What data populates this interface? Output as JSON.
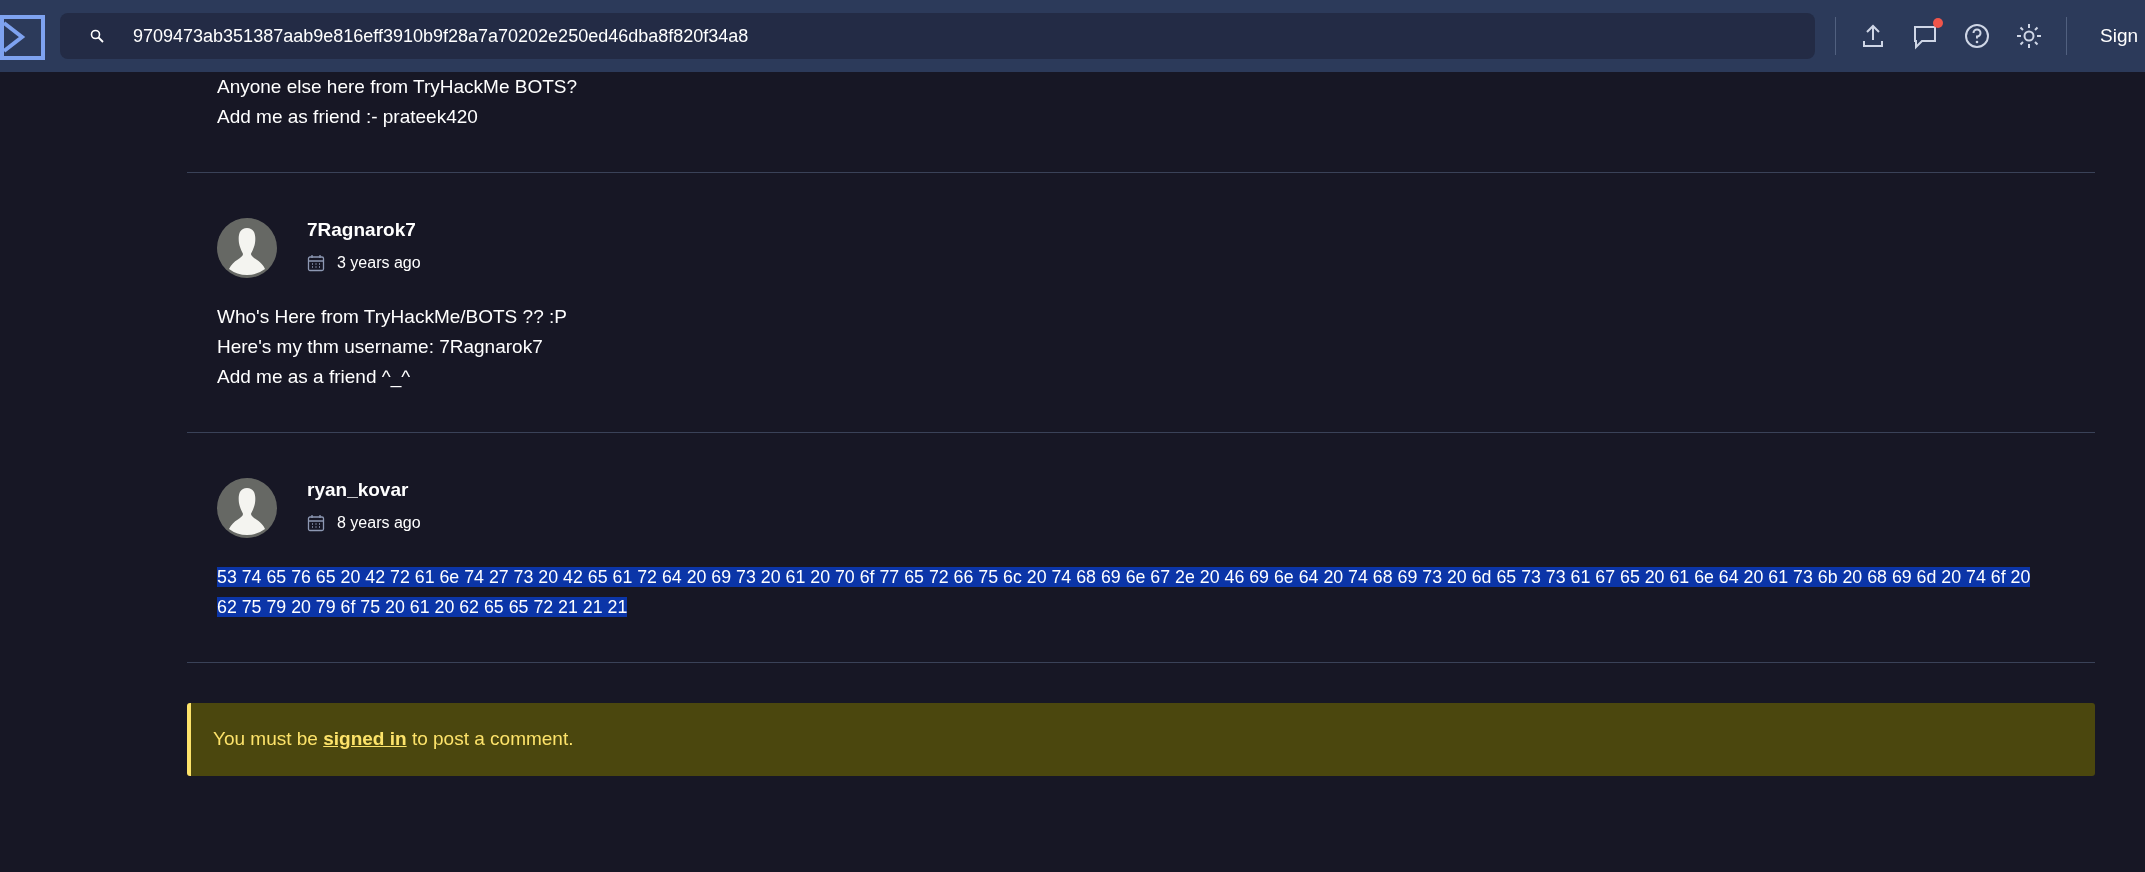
{
  "top_bar": {
    "search": {
      "value": "9709473ab351387aab9e816eff3910b9f28a7a70202e250ed46dba8f820f34a8"
    },
    "notification_badge": true,
    "sign_in_label": "Sign"
  },
  "comments": [
    {
      "lines": [
        "Anyone else here from TryHackMe BOTS?",
        "Add me as friend :- prateek420"
      ],
      "highlighted": false
    },
    {
      "author": "7Ragnarok7",
      "date": "3 years ago",
      "lines": [
        "Who's Here from TryHackMe/BOTS ?? :P",
        "Here's my thm username: 7Ragnarok7",
        "Add me as a friend ^_^"
      ],
      "highlighted": false
    },
    {
      "author": "ryan_kovar",
      "date": "8 years ago",
      "lines": [
        "53 74 65 76 65 20 42 72 61 6e 74 27 73 20 42 65 61 72 64 20 69 73 20 61 20 70 6f 77 65 72 66 75 6c 20 74 68 69 6e 67 2e 20 46 69 6e 64 20 74 68 69 73 20 6d 65 73 73 61 67 65 20 61 6e 64 20 61 73 6b 20 68 69 6d 20 74 6f 20",
        "62 75 79 20 79 6f 75 20 61 20 62 65 65 72 21 21 21"
      ],
      "highlighted": true
    }
  ],
  "notice": {
    "before": "You must be",
    "link": "signed in",
    "after": "to post a comment."
  }
}
